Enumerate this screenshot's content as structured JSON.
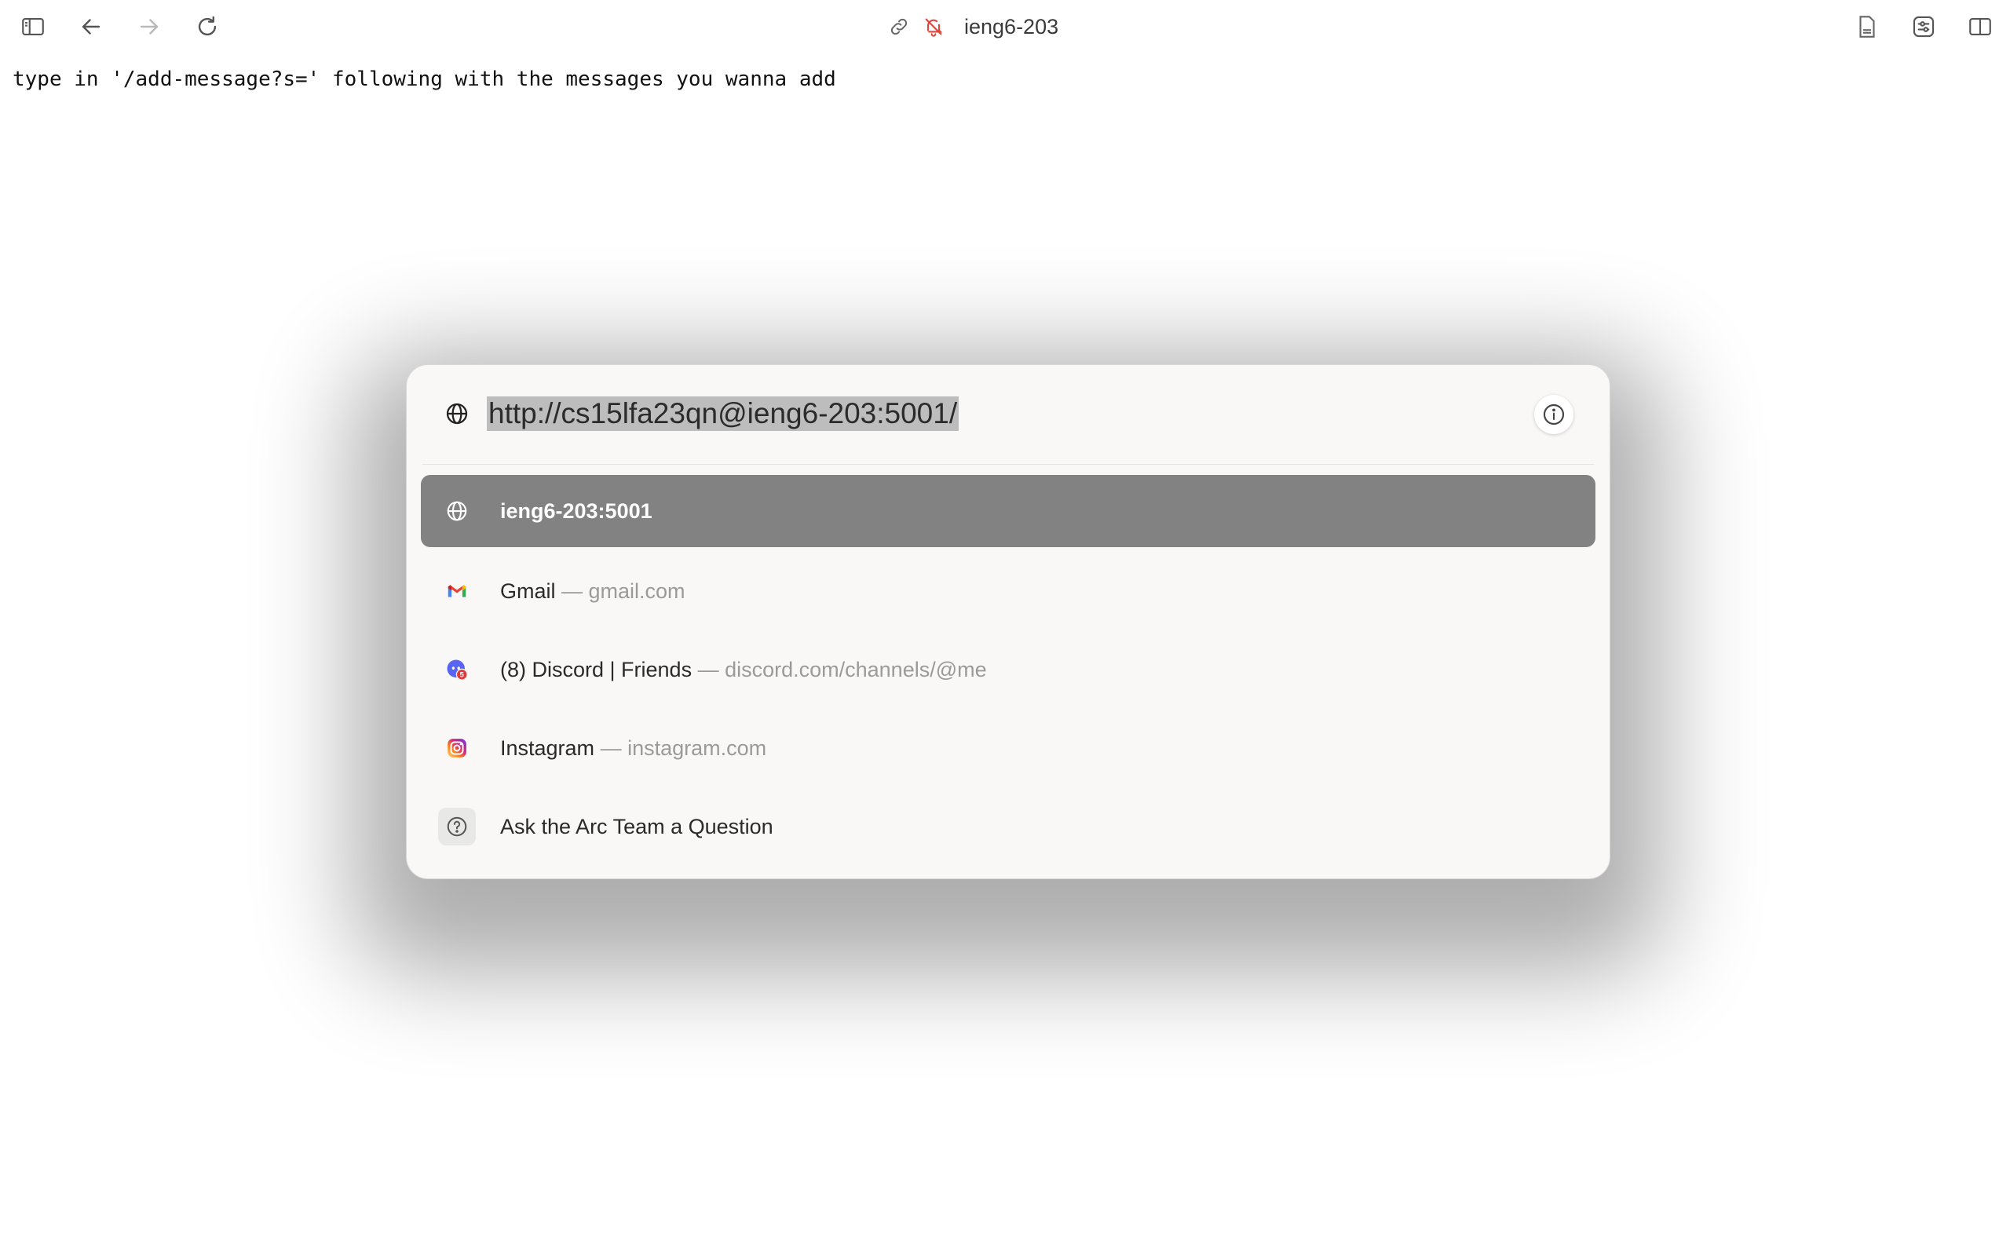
{
  "toolbar": {
    "title": "ieng6-203",
    "icons": {
      "sidebar": "sidebar-toggle-icon",
      "back": "arrow-left-icon",
      "forward": "arrow-right-icon",
      "reload": "reload-icon",
      "link": "link-icon",
      "notifications_off": "bell-slash-icon",
      "reader": "document-icon",
      "site_controls": "sliders-icon",
      "split_view": "split-view-icon"
    },
    "colors": {
      "bell_slash": "#e0463c"
    }
  },
  "page": {
    "text": "type in '/add-message?s=' following with the messages you wanna add"
  },
  "command_bar": {
    "url_value": "http://cs15lfa23qn@ieng6-203:5001/",
    "suggestions": [
      {
        "title": "ieng6-203:5001",
        "subtitle": "",
        "icon": "globe-icon",
        "selected": true
      },
      {
        "title": "Gmail",
        "subtitle": " — gmail.com",
        "icon": "gmail-icon",
        "selected": false
      },
      {
        "title": "(8) Discord | Friends",
        "subtitle": " — discord.com/channels/@me",
        "icon": "discord-icon",
        "badge": "5",
        "selected": false
      },
      {
        "title": "Instagram",
        "subtitle": " — instagram.com",
        "icon": "instagram-icon",
        "selected": false
      },
      {
        "title": "Ask the Arc Team a Question",
        "subtitle": "",
        "icon": "question-icon",
        "selected": false
      }
    ],
    "colors": {
      "selected_row": "#828282",
      "panel_bg": "#f9f8f6",
      "url_highlight": "#bdbdbd"
    }
  }
}
